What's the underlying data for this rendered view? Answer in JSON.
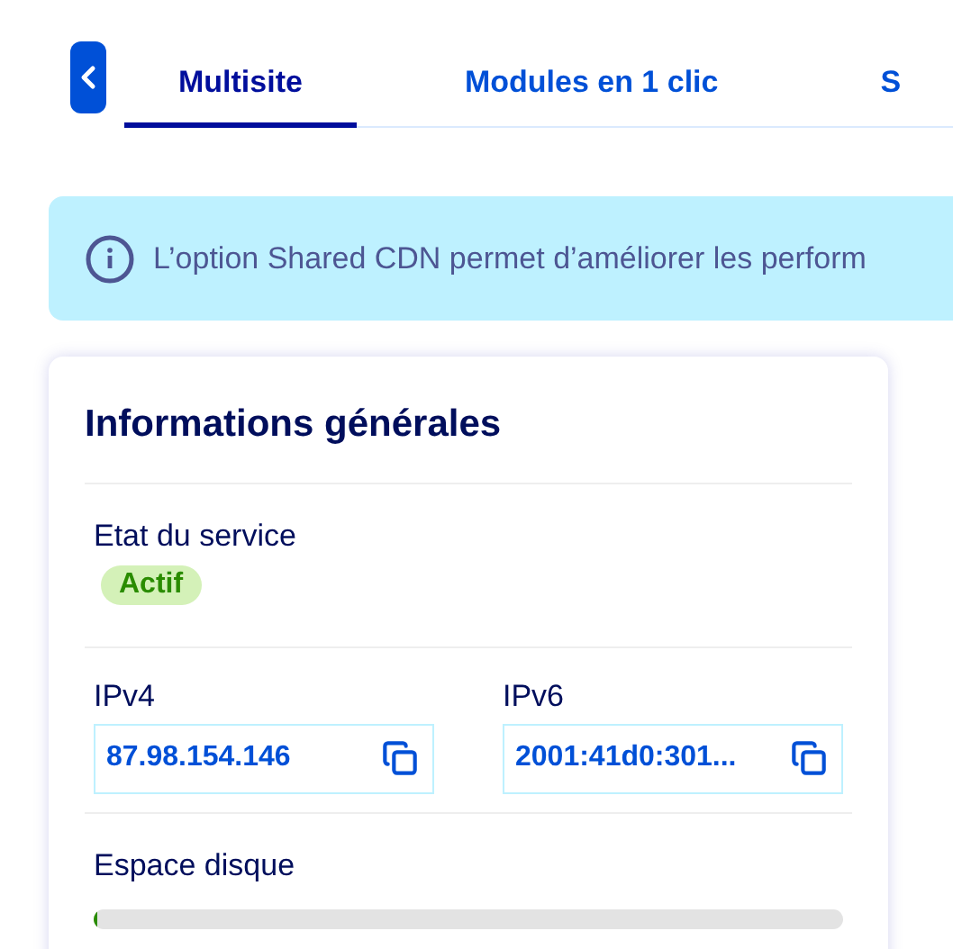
{
  "tabs": [
    {
      "label": "Multisite",
      "selected": true
    },
    {
      "label": "Modules en 1 clic",
      "selected": false
    },
    {
      "label": "S",
      "selected": false
    }
  ],
  "banner": {
    "text": "L’option Shared CDN permet d’améliorer les perform"
  },
  "card": {
    "title": "Informations générales",
    "service": {
      "label": "Etat du service",
      "status": "Actif"
    },
    "addresses": [
      {
        "label": "IPv4",
        "value": "87.98.154.146"
      },
      {
        "label": "IPv6",
        "value": "2001:41d0:301..."
      }
    ],
    "disk": {
      "label": "Espace disque",
      "level": 0.005
    }
  }
}
